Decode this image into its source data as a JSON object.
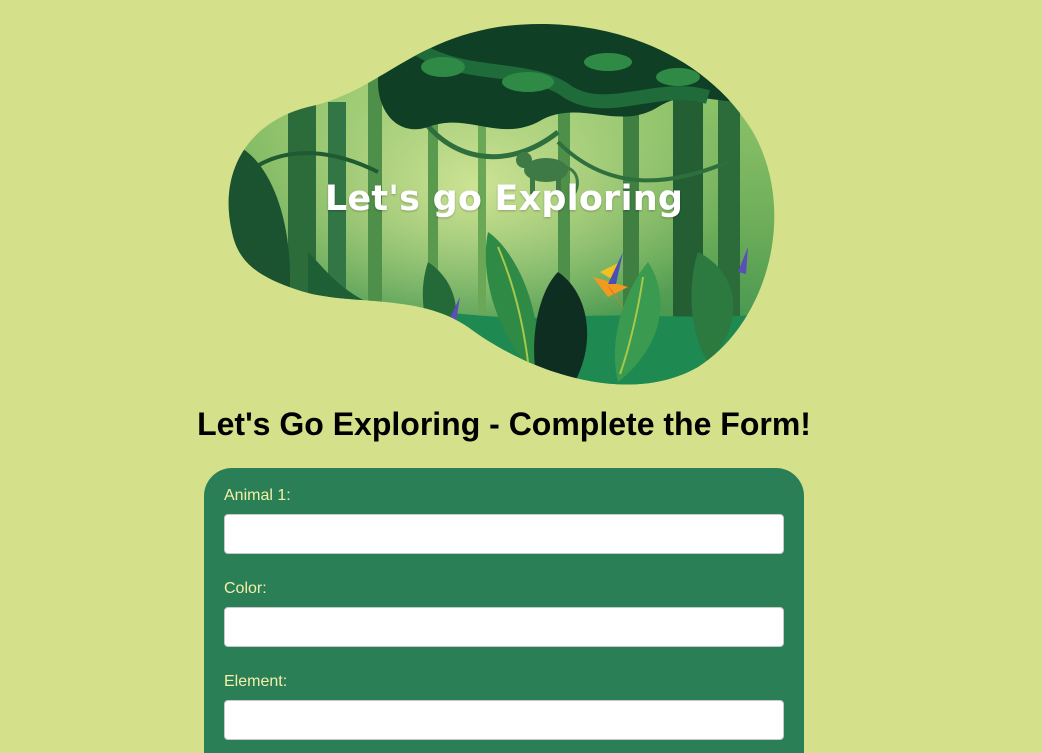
{
  "hero": {
    "title": "Let's go Exploring"
  },
  "page": {
    "heading": "Let's Go Exploring - Complete the Form!"
  },
  "form": {
    "fields": [
      {
        "label": "Animal 1:",
        "value": "",
        "placeholder": ""
      },
      {
        "label": "Color:",
        "value": "",
        "placeholder": ""
      },
      {
        "label": "Element:",
        "value": "",
        "placeholder": ""
      }
    ]
  },
  "colors": {
    "background": "#d4e08a",
    "form_card": "#2b7f57",
    "label_text": "#f3f0a8",
    "jungle_dark": "#0f3f25",
    "jungle_light": "#6fae5a"
  }
}
